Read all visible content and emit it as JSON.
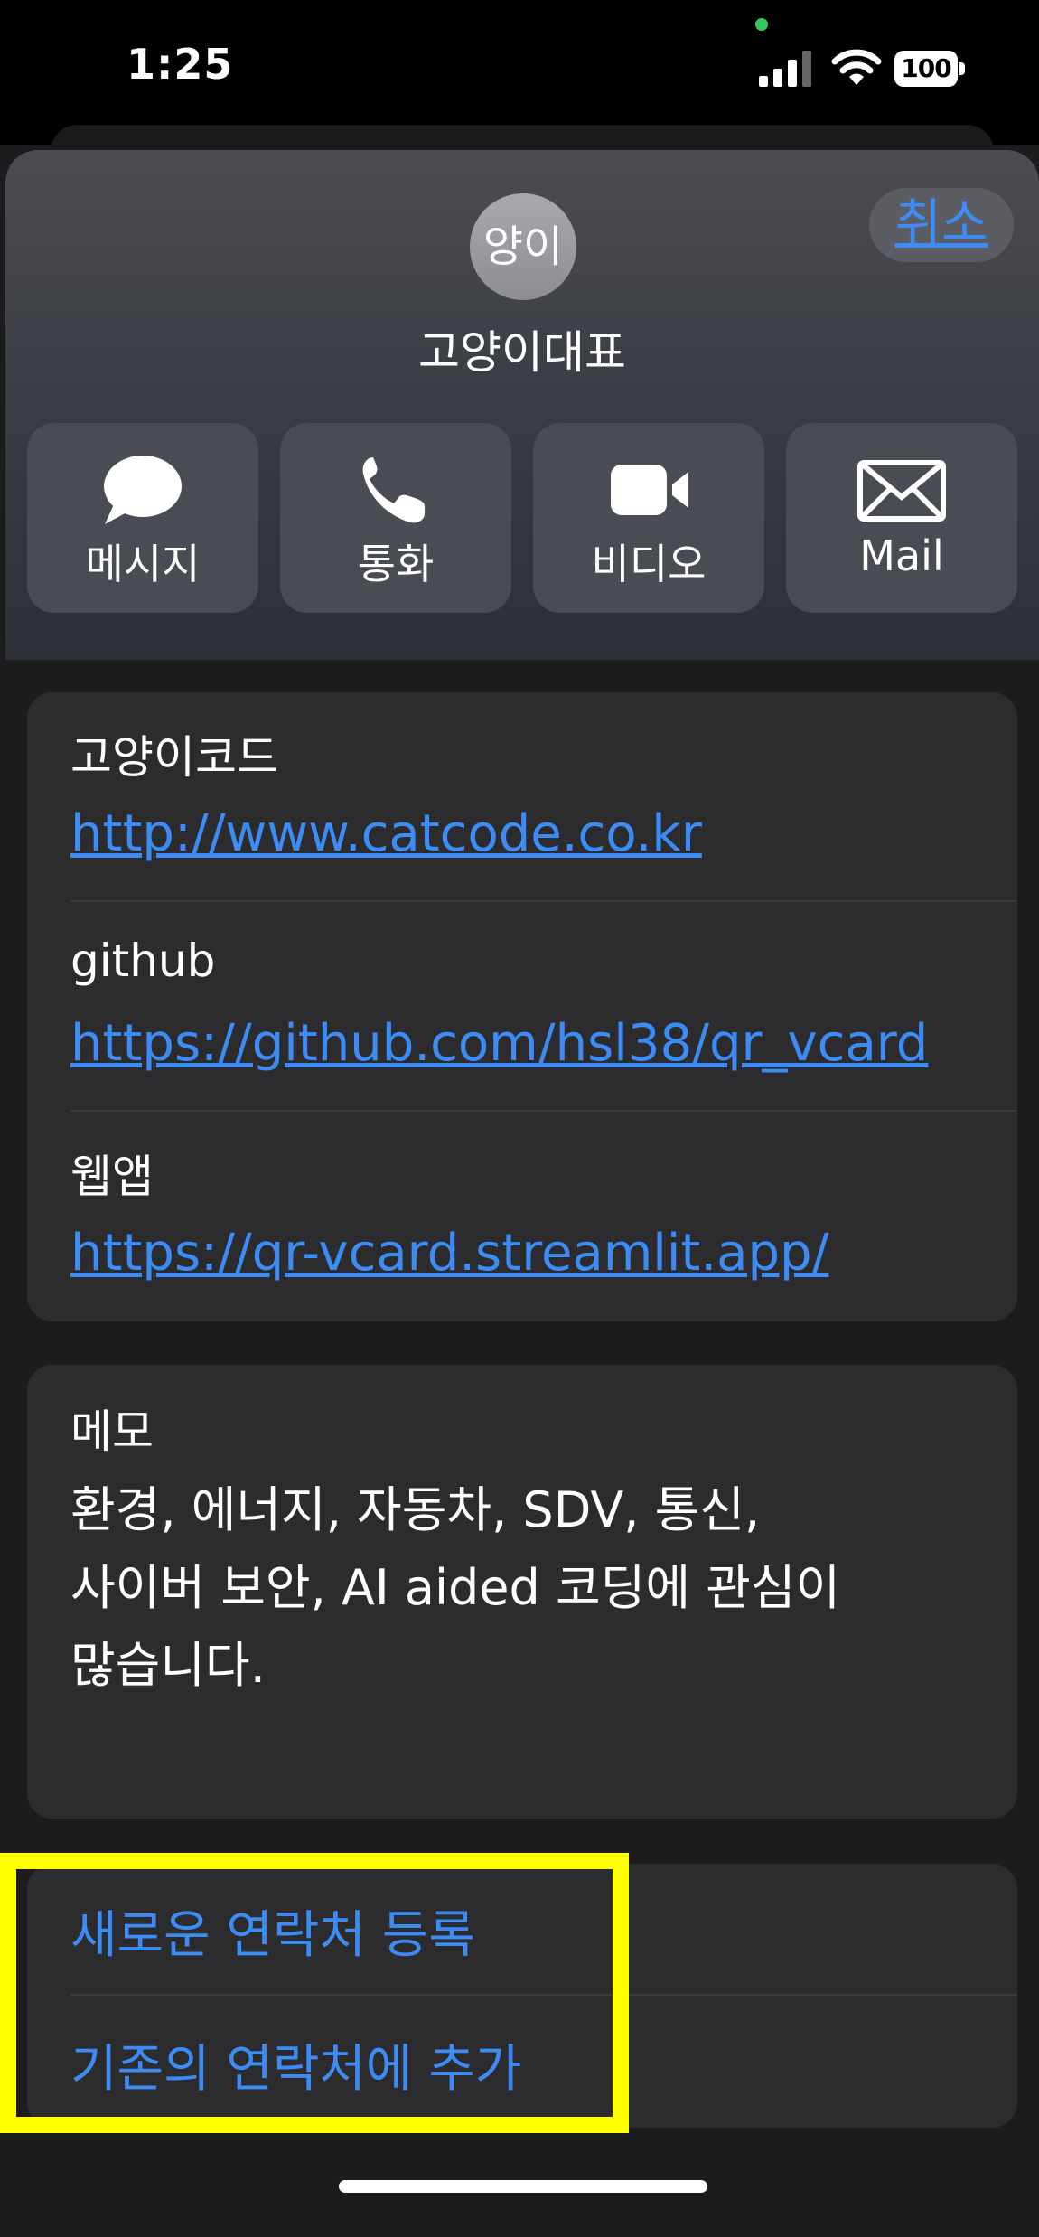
{
  "status_bar": {
    "time": "1:25",
    "battery": "100"
  },
  "header": {
    "cancel_label": "취소",
    "avatar_initials": "양이",
    "name": "고양이대표",
    "actions": [
      {
        "label": "메시지",
        "icon": "message-bubble-icon"
      },
      {
        "label": "통화",
        "icon": "phone-icon"
      },
      {
        "label": "비디오",
        "icon": "video-camera-icon"
      },
      {
        "label": "Mail",
        "icon": "mail-envelope-icon"
      }
    ]
  },
  "links_card": {
    "items": [
      {
        "label": "고양이코드",
        "url": "http://www.catcode.co.kr"
      },
      {
        "label": "github",
        "url": "https://github.com/hsl38/qr_vcard"
      },
      {
        "label": "웹앱",
        "url": "https://qr-vcard.streamlit.app/"
      }
    ]
  },
  "memo_card": {
    "label": "메모",
    "lines": [
      "환경, 에너지, 자동차, SDV, 통신,",
      "사이버 보안, AI aided 코딩에 관심이",
      "많습니다."
    ]
  },
  "contact_actions": {
    "create_new": "새로운 연락처 등록",
    "add_existing": "기존의 연락처에 추가"
  },
  "colors": {
    "accent": "#3d8cf5",
    "highlight": "#ffff00",
    "background": "#1c1c1e",
    "card": "#2c2c2e"
  }
}
